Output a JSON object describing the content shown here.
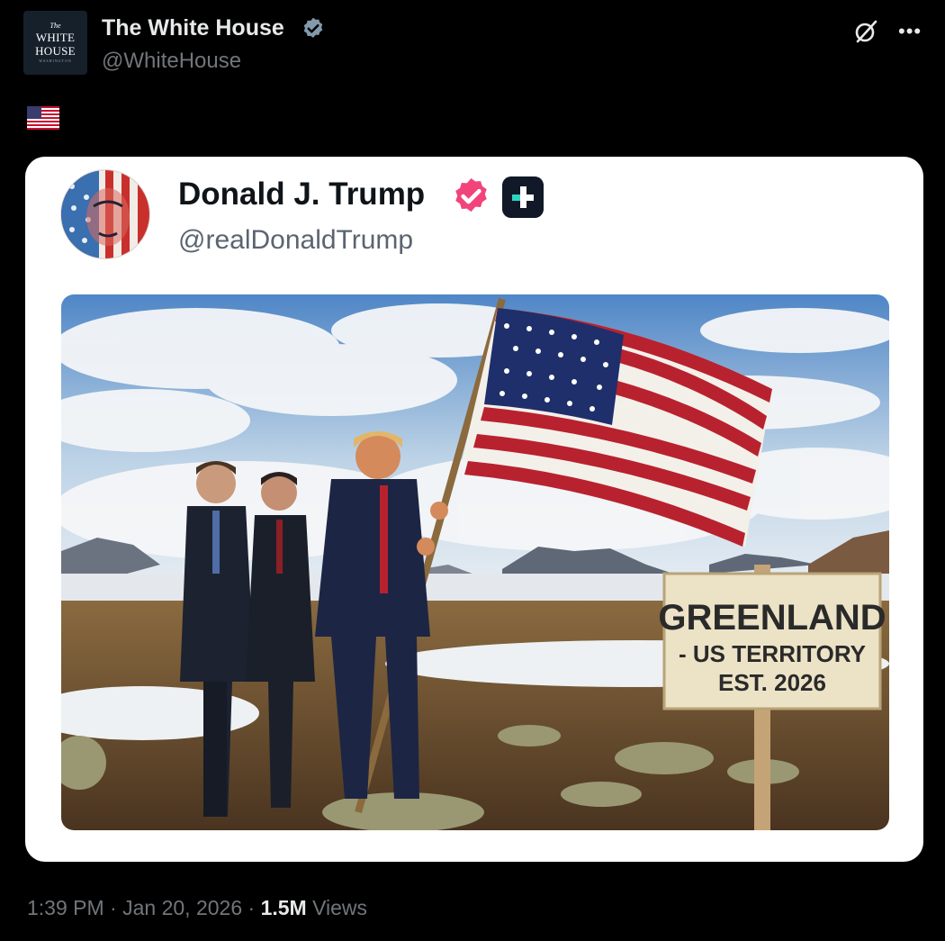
{
  "post": {
    "author_name": "The White House",
    "author_handle": "@WhiteHouse",
    "avatar_text": {
      "line1": "The",
      "line2": "WHITE",
      "line3": "HOUSE",
      "line4": "WASHINGTON"
    },
    "icons": {
      "verified": "verified-badge-icon",
      "grok": "grok-icon",
      "more": "more-options-icon",
      "flag": "us-flag-emoji"
    }
  },
  "embedded": {
    "author_name": "Donald J. Trump",
    "author_handle": "@realDonaldTrump",
    "badge_color": "#f0447a",
    "image": {
      "sign_line1": "GREENLAND",
      "sign_line2": "- US TERRITORY",
      "sign_line3": "EST. 2026"
    }
  },
  "meta": {
    "time": "1:39 PM",
    "date": "Jan 20, 2026",
    "views_count": "1.5M",
    "views_label": "Views"
  },
  "colors": {
    "background": "#000000",
    "text": "#e7e9ea",
    "muted": "#71767b"
  }
}
